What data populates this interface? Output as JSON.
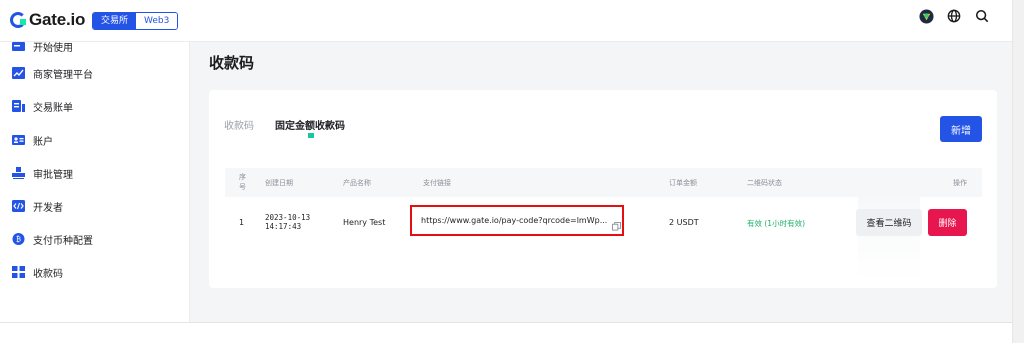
{
  "header": {
    "logo_text": "Gate.io",
    "switcher": [
      "交易所",
      "Web3"
    ],
    "icons": [
      "avatar-icon",
      "globe-icon",
      "search-icon"
    ]
  },
  "sidebar": {
    "items": [
      {
        "label": "开始使用",
        "icon": "rocket-icon"
      },
      {
        "label": "商家管理平台",
        "icon": "chart-icon"
      },
      {
        "label": "交易账单",
        "icon": "bill-icon"
      },
      {
        "label": "账户",
        "icon": "account-icon"
      },
      {
        "label": "审批管理",
        "icon": "approval-icon"
      },
      {
        "label": "开发者",
        "icon": "code-icon"
      },
      {
        "label": "支付币种配置",
        "icon": "coin-icon"
      },
      {
        "label": "收款码",
        "icon": "grid-icon"
      }
    ],
    "active_index": 7
  },
  "main": {
    "title": "收款码",
    "tabs": [
      "收款码",
      "固定金额收款码"
    ],
    "active_tab": 1,
    "add_label": "新增"
  },
  "table": {
    "headers": {
      "index": [
        "序",
        "号"
      ],
      "created": "创建日期",
      "product": "产品名称",
      "link": "支付链接",
      "amount": "订单金额",
      "qr_status": "二维码状态",
      "action": "操作"
    },
    "rows": [
      {
        "index": "1",
        "date": "2023-10-13",
        "time": "14:17:43",
        "product": "Henry Test",
        "link": "https://www.gate.io/pay-code?qrcode=lmWp...",
        "amount": "2 USDT",
        "status": "有效 (1小时有效)",
        "view_label": "查看二维码",
        "delete_label": "删除"
      }
    ]
  },
  "colors": {
    "accent": "#2354e6",
    "danger": "#e8164e",
    "success": "#17b26a",
    "highlight": "#e60f0f"
  }
}
